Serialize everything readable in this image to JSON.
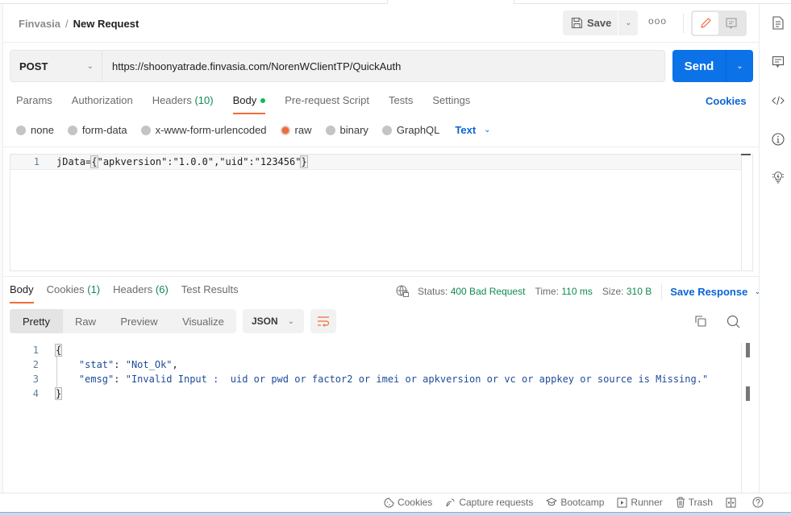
{
  "header": {
    "workspace": "Finvasia",
    "separator": "/",
    "request_name": "New Request",
    "save_label": "Save",
    "more_label": "ooo"
  },
  "request": {
    "method": "POST",
    "url": "https://shoonyatrade.finvasia.com/NorenWClientTP/QuickAuth",
    "send_label": "Send"
  },
  "request_tabs": [
    {
      "label": "Params",
      "count": ""
    },
    {
      "label": "Authorization",
      "count": ""
    },
    {
      "label": "Headers",
      "count": "(10)"
    },
    {
      "label": "Body",
      "count": "",
      "active": true
    },
    {
      "label": "Pre-request Script",
      "count": ""
    },
    {
      "label": "Tests",
      "count": ""
    },
    {
      "label": "Settings",
      "count": ""
    }
  ],
  "cookies_link": "Cookies",
  "body_types": [
    {
      "label": "none"
    },
    {
      "label": "form-data"
    },
    {
      "label": "x-www-form-urlencoded"
    },
    {
      "label": "raw",
      "checked": true
    },
    {
      "label": "binary"
    },
    {
      "label": "GraphQL"
    }
  ],
  "raw_type": "Text",
  "request_body": {
    "lines": [
      {
        "num": "1",
        "text": "jData={\"apkversion\":\"1.0.0\",\"uid\":\"123456\"}"
      }
    ],
    "prefix": "jData=",
    "open_brace": "{",
    "middle": "\"apkversion\":\"1.0.0\",\"uid\":\"123456\"",
    "close_brace": "}"
  },
  "response_tabs": [
    {
      "label": "Body",
      "count": "",
      "active": true
    },
    {
      "label": "Cookies",
      "count": "(1)"
    },
    {
      "label": "Headers",
      "count": "(6)"
    },
    {
      "label": "Test Results",
      "count": ""
    }
  ],
  "response_meta": {
    "status_label": "Status:",
    "status_value": "400 Bad Request",
    "time_label": "Time:",
    "time_value": "110 ms",
    "size_label": "Size:",
    "size_value": "310 B",
    "save_response": "Save Response"
  },
  "response_views": [
    "Pretty",
    "Raw",
    "Preview",
    "Visualize"
  ],
  "response_format": "JSON",
  "response_body": {
    "line_numbers": [
      "1",
      "2",
      "3",
      "4"
    ],
    "open_brace": "{",
    "close_brace": "}",
    "stat_key": "\"stat\"",
    "stat_value": "\"Not_Ok\"",
    "emsg_key": "\"emsg\"",
    "emsg_value": "\"Invalid Input :  uid or pwd or factor2 or imei or apkversion or vc or appkey or source is Missing.\""
  },
  "footer": {
    "items": [
      "Cookies",
      "Capture requests",
      "Bootcamp",
      "Runner",
      "Trash"
    ]
  },
  "colors": {
    "accent_orange": "#f26b3a",
    "send_blue": "#0b72e7",
    "link_blue": "#0b64d4",
    "status_green": "#0e8a52"
  }
}
